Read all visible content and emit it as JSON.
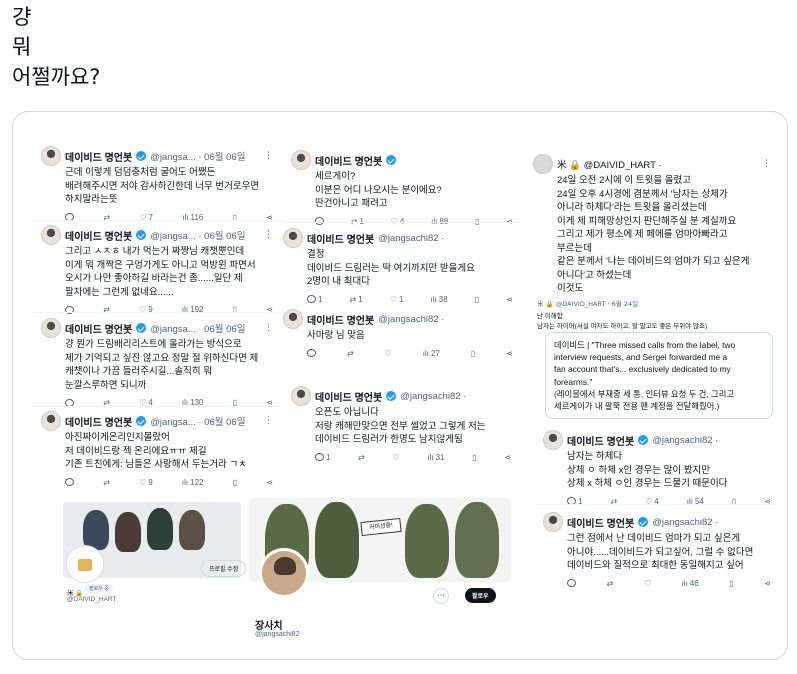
{
  "post": {
    "lines": [
      "걍",
      "뭐",
      "어쩔까요?"
    ]
  },
  "tweets": {
    "a1": {
      "name": "데이비드 명언봇",
      "handle": "@jangsa... · 06월 06일",
      "body": "근데 이렇게 덤덤충처럼 굴어도 어쨌든\n배려해주시면 저야 감사하긴한데 너무 번거로우면\n하지말라는뜻",
      "likes": "7",
      "views": "116"
    },
    "a2": {
      "name": "데이비드 명언봇",
      "handle": "@jangsa... · 06월 06일",
      "body": "그리고 ㅅㅈㅎ 내가 먹는거 짜짱님 캐챗뿐인데\n이게 뭐 개짝은 구엉가게도 아니고 먹방윈 파면서\n오시가 나만 좋아하길 바라는건 좀......일단 제\n팔자에는 그런게 없네요......",
      "likes": "9",
      "views": "192"
    },
    "a3": {
      "name": "데이비드 명언봇",
      "handle": "@jangsa... · 06월 06일",
      "body": "걍 뭔가 드림배리리스트에 올라가는 방식으로\n제가 기억되고 싶진 않고요 정말 절 위하신다면 제\n캐챗이나 가끔 들러주시길...솔직히 뭐\n눈깔스루하면 되니까",
      "likes": "4",
      "views": "130"
    },
    "a4": {
      "name": "데이비드 명언봇",
      "handle": "@jangsa... · 06월 06일",
      "body": "아진짜이게온리인지몰랐어\n저 데이비드랑 젝 온리에요ㅠㅠ 제길\n기존 트친에게: 님들은 사랑해서 두는거라 ㄱㅊ",
      "likes": "9",
      "views": "122"
    },
    "b1": {
      "name": "데이비드 명언봇",
      "body": "세르게이?\n이분은 어디 나오시는 분이에요?\n딴건아니고 패려고",
      "retweets": "1",
      "likes": "4",
      "views": "88"
    },
    "b2": {
      "name": "데이비드 명언봇",
      "handle": "@jangsachi82 ·",
      "body": "결정\n데이비드 드림러는 딱 여기까지만 받을게요\n2명이 내 최대다",
      "replies": "1",
      "retweets": "1",
      "likes": "1",
      "views": "38"
    },
    "b3": {
      "name": "데이비드 명언봇",
      "handle": "@jangsachi82 ·",
      "body": "사마랑 님 맞음",
      "views": "27"
    },
    "c1": {
      "name": "데이비드 명언봇",
      "handle": "@jangsachi82 ·",
      "body": "오픈도 아닙니다\n저랑 캐해만맞으면 전부 썰었고 그렇게 저는\n데이비드 드림러가 한명도 남지않게됨",
      "replies": "1",
      "views": "31"
    },
    "d1": {
      "name": "米 🔒 @DAIVID_HART ·",
      "body": "24일 오전 2시에 이 트윗을 올렸고\n24일 오후 4시경에 겸분께서 '남자는 상체가\n아니라 하체다'라는 트윗을 올리셨는데\n이게 제 피해망상인지 판단해주실 분 계실까요\n그리고 제가 평소에 제 페에를 엄마아빠라고\n부르는데\n같은 분께서 '나는 데이비드의 엄마가 되고 싶은게\n아니다'고 하셨는데\n이것도"
    },
    "d2": {
      "header": "米 🔒 @DAIVID_HART · 6월 24일",
      "sub1": "난 이해함",
      "sub2": "남자는 하이머(서실 여자도 하이고, 할 말고도 좋은 부위야 많죠)",
      "quote": "데이비드 | \"Three missed calls from the label, two\ninterview requests, and Sergei forwarded me a\nfan account that's... exclusively dedicated to my\nforearms.\"\n(레이블에서 부재중 세 통, 인터뷰 요청 두 건, 그리고\n세르게이가 내 팔뚝 전용 팬 계정을 전달해줬어.)"
    },
    "d3": {
      "name": "데이비드 명언봇",
      "handle": "@jangsachi82 ·",
      "body": "남자는 하체다\n상체 ㅇ 하체 x인 경우는 많이 봤지만\n상체 x 하체 ㅇ인 경우는 드물기 때문이다",
      "replies": "1",
      "likes": "4",
      "views": "54"
    },
    "d4": {
      "name": "데이비드 명언봇",
      "handle": "@jangsachi82 ·",
      "body": "그런 점에서 난 데이비드 엄마가 되고 싶은게\n아니야......데이비드가 되고싶어, 그럴 수 없다면\n데이비드와 질적으로 최대한 동일해지고 싶어",
      "views": "46"
    }
  },
  "profile_left": {
    "name_line": "米 🔒",
    "pill": "팔로우 중",
    "handle": "@DAIVID_HART",
    "button": "프로필 수정"
  },
  "profile_right": {
    "name": "장사치",
    "handle": "@jangsachi82",
    "sign": "커미션중!",
    "follow": "팔로우"
  },
  "colors": {
    "accent": "#1d9bf0",
    "text": "#0f1419",
    "muted": "#536471",
    "border": "#cfd9de"
  }
}
